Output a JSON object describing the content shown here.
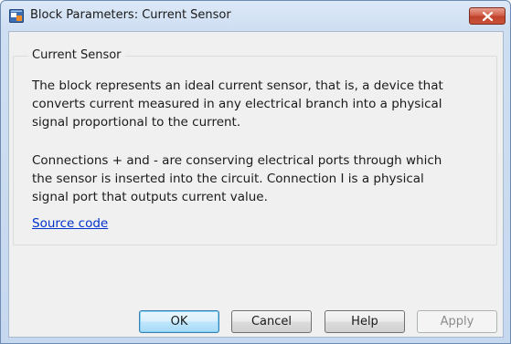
{
  "window": {
    "title": "Block Parameters: Current Sensor",
    "icon": "simulink-block-icon",
    "close_icon": "close-icon"
  },
  "group": {
    "title": "Current Sensor",
    "paragraph_1": [
      "The block represents an ideal current sensor, that is, a device that",
      "converts current measured in any electrical branch into a physical",
      "signal proportional to the current."
    ],
    "paragraph_2": [
      "Connections + and - are conserving electrical ports through which",
      "the sensor is inserted into the circuit. Connection I is a physical",
      "signal port that outputs current value."
    ],
    "link_label": "Source code"
  },
  "buttons": {
    "ok": "OK",
    "cancel": "Cancel",
    "help": "Help",
    "apply": "Apply"
  },
  "colors": {
    "link": "#0033cc",
    "close_button": "#c9533a",
    "default_button_border": "#3c7fb1",
    "disabled_text": "#8c8c8c"
  }
}
